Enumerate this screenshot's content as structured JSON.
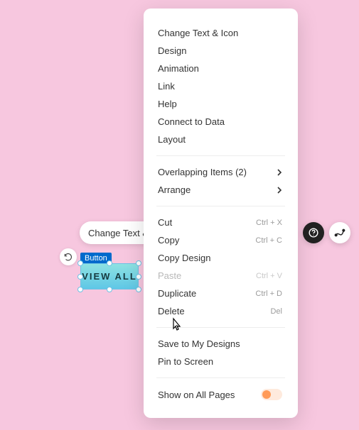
{
  "toolbar": {
    "change_text": "Change Text & Icon"
  },
  "selected": {
    "label": "Button",
    "text": "VIEW ALL"
  },
  "menu": {
    "group1": [
      "Change Text & Icon",
      "Design",
      "Animation",
      "Link",
      "Help",
      "Connect to Data",
      "Layout"
    ],
    "overlapping": {
      "label": "Overlapping Items (2)"
    },
    "arrange": {
      "label": "Arrange"
    },
    "cut": {
      "label": "Cut",
      "shortcut": "Ctrl + X"
    },
    "copy": {
      "label": "Copy",
      "shortcut": "Ctrl + C"
    },
    "copy_design": {
      "label": "Copy Design"
    },
    "paste": {
      "label": "Paste",
      "shortcut": "Ctrl + V"
    },
    "duplicate": {
      "label": "Duplicate",
      "shortcut": "Ctrl + D"
    },
    "delete": {
      "label": "Delete",
      "shortcut": "Del"
    },
    "save": {
      "label": "Save to My Designs"
    },
    "pin": {
      "label": "Pin to Screen"
    },
    "show_all": {
      "label": "Show on All Pages"
    }
  }
}
